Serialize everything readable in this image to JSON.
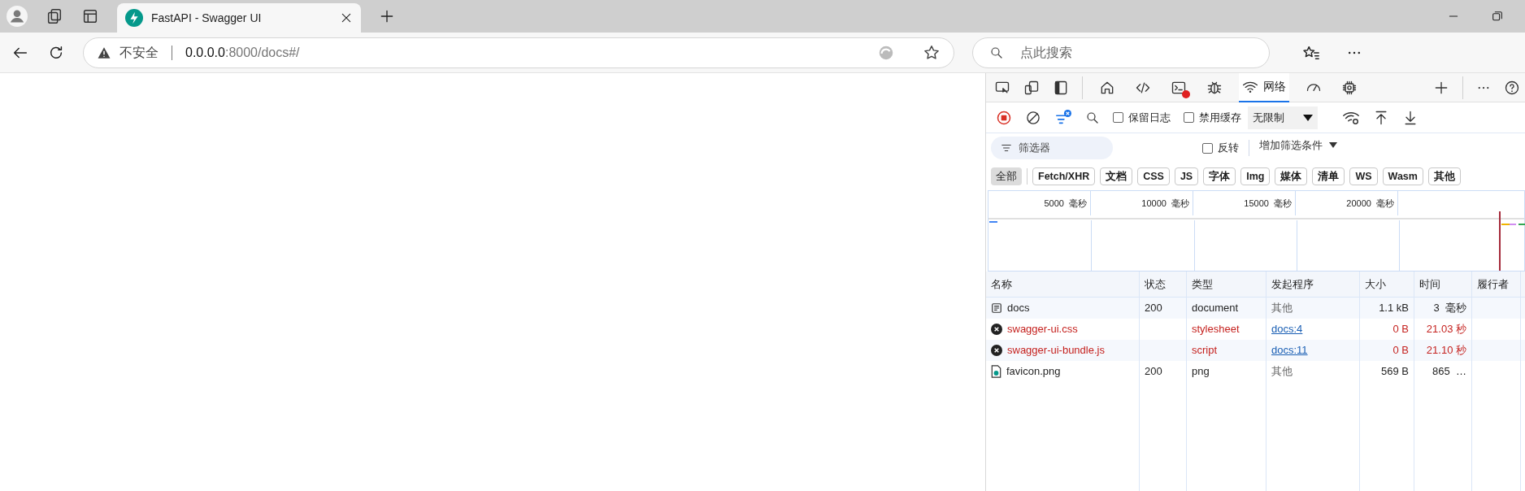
{
  "browser": {
    "tab": {
      "title": "FastAPI - Swagger UI"
    },
    "address": {
      "security_label": "不安全",
      "host": "0.0.0.0",
      "path": ":8000/docs#/"
    },
    "search": {
      "placeholder": "点此搜索"
    }
  },
  "devtools": {
    "tabs": [
      {
        "kind": "home",
        "selected": false
      },
      {
        "kind": "elements",
        "selected": false
      },
      {
        "kind": "console",
        "selected": false,
        "error_badge": true
      },
      {
        "kind": "sources",
        "selected": false
      },
      {
        "kind": "network",
        "label": "网络",
        "selected": true
      },
      {
        "kind": "performance",
        "selected": false
      },
      {
        "kind": "memory",
        "selected": false
      }
    ],
    "toolbar": {
      "recording": true,
      "preserve_log": {
        "label": "保留日志",
        "checked": false
      },
      "disable_cache": {
        "label": "禁用缓存",
        "checked": false
      },
      "throttling": "无限制"
    },
    "filter": {
      "placeholder": "筛选器",
      "invert": {
        "label": "反转",
        "checked": false
      },
      "more_filters": "增加筛选条件"
    },
    "types": [
      {
        "label": "全部",
        "selected": true
      },
      {
        "label": "Fetch/XHR",
        "selected": false
      },
      {
        "label": "文档",
        "selected": false
      },
      {
        "label": "CSS",
        "selected": false
      },
      {
        "label": "JS",
        "selected": false
      },
      {
        "label": "字体",
        "selected": false
      },
      {
        "label": "Img",
        "selected": false
      },
      {
        "label": "媒体",
        "selected": false
      },
      {
        "label": "清单",
        "selected": false
      },
      {
        "label": "WS",
        "selected": false
      },
      {
        "label": "Wasm",
        "selected": false
      },
      {
        "label": "其他",
        "selected": false
      }
    ],
    "timeline": {
      "ticks": [
        "5000  毫秒",
        "10000  毫秒",
        "15000  毫秒",
        "20000  毫秒"
      ]
    },
    "table": {
      "columns": [
        "名称",
        "状态",
        "类型",
        "发起程序",
        "大小",
        "时间",
        "履行者"
      ],
      "rows": [
        {
          "kind": "document",
          "failed": false,
          "name": "docs",
          "status": "200",
          "type": "document",
          "initiator": "其他",
          "initiator_link": false,
          "size": "1.1 kB",
          "time": "3  毫秒"
        },
        {
          "kind": "error",
          "failed": true,
          "name": "swagger-ui.css",
          "type": "stylesheet",
          "initiator": "docs:4",
          "initiator_link": true,
          "size": "0 B",
          "time": "21.03 秒"
        },
        {
          "kind": "error",
          "failed": true,
          "name": "swagger-ui-bundle.js",
          "type": "script",
          "initiator": "docs:11",
          "initiator_link": true,
          "size": "0 B",
          "time": "21.10 秒"
        },
        {
          "kind": "image",
          "failed": false,
          "name": "favicon.png",
          "status": "200",
          "type": "png",
          "initiator": "其他",
          "initiator_link": false,
          "size": "569 B",
          "time": "865  …"
        }
      ]
    }
  }
}
